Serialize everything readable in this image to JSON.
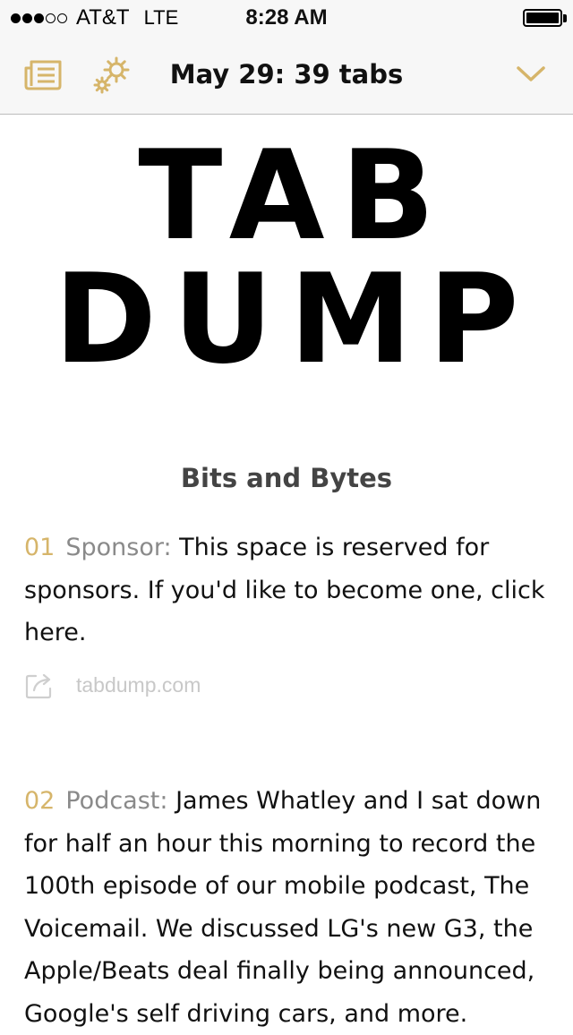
{
  "status_bar": {
    "signal_dots_filled": 3,
    "signal_dots_total": 5,
    "carrier": "AT&T",
    "network": "LTE",
    "time": "8:28 AM",
    "battery_level": 1.0
  },
  "nav_bar": {
    "title": "May 29: 39 tabs",
    "left_icons": [
      "newspaper-icon",
      "gears-icon"
    ],
    "right_icon": "chevron-down-icon",
    "accent_color": "#d6b56a"
  },
  "masthead": {
    "line1": "TAB",
    "line2": "DUMP"
  },
  "section": {
    "title": "Bits and Bytes"
  },
  "items": [
    {
      "number": "01",
      "category": "Sponsor:",
      "text": "This space is reserved for sponsors. If you'd like to become one, click here.",
      "source": "tabdump.com"
    },
    {
      "number": "02",
      "category": "Podcast:",
      "text": "James Whatley and I sat down for half an hour this morning to record the 100th episode of our mobile podcast, The Voicemail. We discussed LG's new G3, the Apple/Beats deal finally being announced, Google's self driving cars, and more."
    }
  ]
}
